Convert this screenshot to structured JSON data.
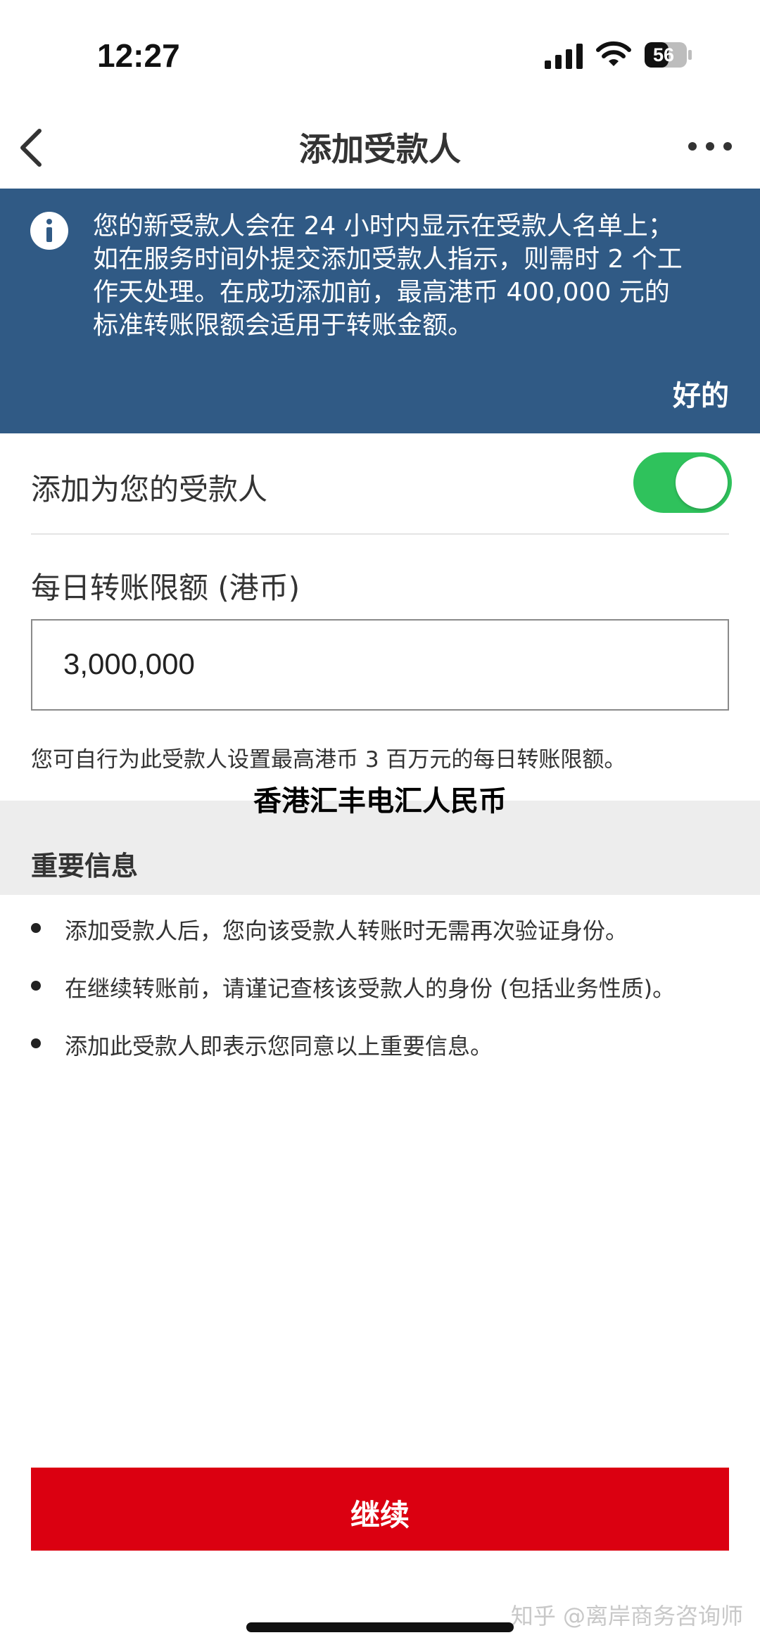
{
  "status_bar": {
    "time": "12:27",
    "battery": "56",
    "icons": [
      "signal-icon",
      "wifi-icon",
      "battery-icon"
    ]
  },
  "nav": {
    "title": "添加受款人",
    "back_icon": "chevron-left-icon",
    "more_icon": "more-horizontal-icon"
  },
  "banner": {
    "icon": "info-icon",
    "lines": [
      "您的新受款人会在 24 小时内显示在受款人名单上；",
      "如在服务时间外提交添加受款人指示，则需时 2 个工",
      "作天处理。在成功添加前，最高港币 400,000 元的",
      "标准转账限额会适用于转账金额。"
    ],
    "ok_label": "好的",
    "color": "#305a85"
  },
  "add_payee": {
    "label": "添加为您的受款人",
    "toggle_on": true,
    "toggle_color": "#2fc25c"
  },
  "limit": {
    "label": "每日转账限额 (港币)",
    "value": "3,000,000",
    "hint": "您可自行为此受款人设置最高港币 3 百万元的每日转账限额。"
  },
  "overlay_title": "香港汇丰电汇人民币",
  "important": {
    "title": "重要信息",
    "items": [
      "添加受款人后，您向该受款人转账时无需再次验证身份。",
      "在继续转账前，请谨记查核该受款人的身份 (包括业务性质)。",
      "添加此受款人即表示您同意以上重要信息。"
    ]
  },
  "continue_button": {
    "label": "继续",
    "color": "#db0011"
  },
  "watermark": "知乎 @离岸商务咨询师"
}
